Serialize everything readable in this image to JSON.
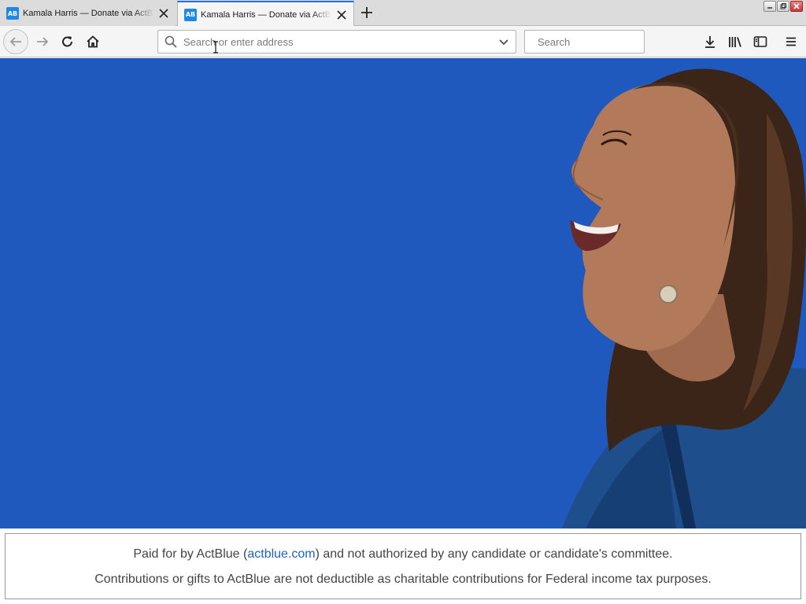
{
  "browser": {
    "tabs": [
      {
        "title": "Kamala Harris — Donate via ActBlue",
        "favicon_text": "AB",
        "active": false
      },
      {
        "title": "Kamala Harris — Donate via ActBlue",
        "favicon_text": "AB",
        "active": true
      }
    ],
    "address_bar": {
      "placeholder": "Search or enter address",
      "value": ""
    },
    "search_bar": {
      "placeholder": "Search",
      "value": ""
    }
  },
  "footer": {
    "line1_prefix": "Paid for by ActBlue (",
    "line1_link": "actblue.com",
    "line1_suffix": ") and not authorized by any candidate or candidate's committee.",
    "line2": "Contributions or gifts to ActBlue are not deductible as charitable contributions for Federal income tax purposes."
  },
  "colors": {
    "hero_background": "#2059be",
    "link": "#1e63c4",
    "favicon": "#1e88e5",
    "active_tab_accent": "#2a6ed6"
  },
  "icons": [
    "back-arrow-icon",
    "forward-arrow-icon",
    "reload-icon",
    "home-icon",
    "search-icon",
    "dropdown-chevron-icon",
    "download-icon",
    "library-icon",
    "sidebar-icon",
    "menu-icon",
    "close-icon",
    "plus-icon"
  ]
}
